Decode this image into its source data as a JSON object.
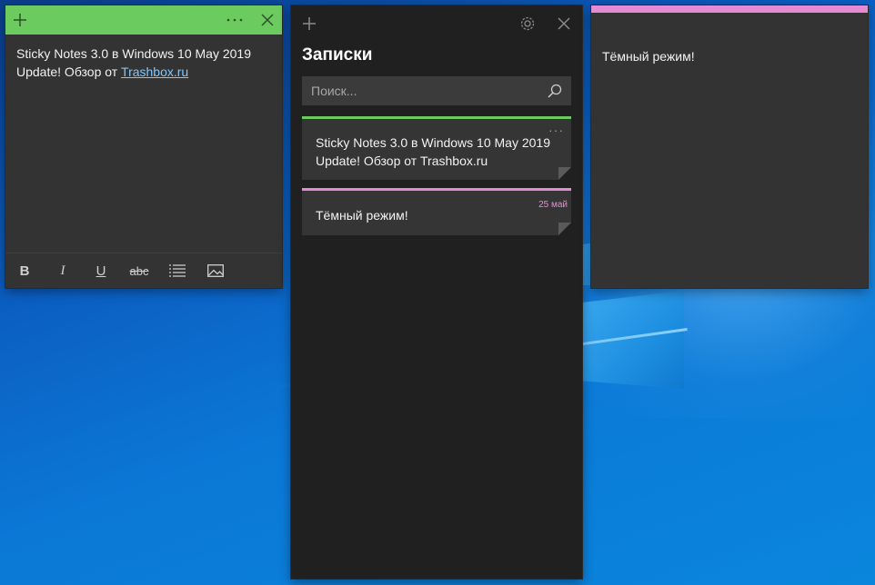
{
  "colors": {
    "green_accent": "#6ccb5f",
    "pink_accent": "#e58bd3",
    "note_bg": "#333333",
    "list_bg": "#202020"
  },
  "left_note": {
    "text_line1": "Sticky Notes 3.0 в Windows 10 May 2019",
    "text_line2": "Update! Обзор от ",
    "link_text": "Trashbox.ru",
    "toolbar": {
      "bold": "B",
      "italic": "I",
      "underline": "U",
      "strikethrough": "abc"
    }
  },
  "notes_list": {
    "title": "Записки",
    "search_placeholder": "Поиск...",
    "cards": [
      {
        "text_line1": "Sticky Notes 3.0 в Windows 10 May 2019",
        "text_line2": "Update! Обзор от Trashbox.ru",
        "menu": "···",
        "color": "#6ccb5f"
      },
      {
        "text": "Тёмный режим!",
        "date": "25 май",
        "color": "#e58bd3"
      }
    ]
  },
  "right_note": {
    "text": "Тёмный режим!"
  }
}
